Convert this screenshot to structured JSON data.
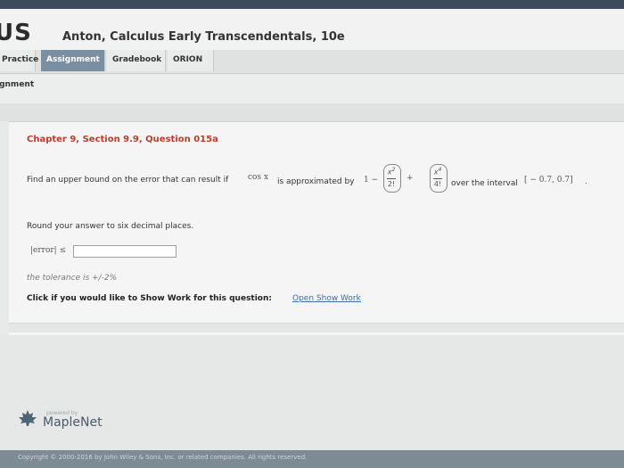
{
  "header": {
    "logo_text": "US",
    "book_title": "Anton, Calculus Early Transcendentals, 10e"
  },
  "tabs": [
    {
      "label": "Practice",
      "active": false
    },
    {
      "label": "Assignment",
      "active": true
    },
    {
      "label": "Gradebook",
      "active": false
    },
    {
      "label": "ORION",
      "active": false
    }
  ],
  "subtitle": "ignment",
  "question": {
    "title": "Chapter 9, Section 9.9, Question 015a",
    "prompt_part1": "Find an upper bound on the error that can result if",
    "func": "cos x",
    "prompt_part2": "is approximated by",
    "poly_const": "1 −",
    "poly_plus": "+",
    "term1_num": "x",
    "term1_exp": "2",
    "term1_den": "2!",
    "term2_num": "x",
    "term2_exp": "4",
    "term2_den": "4!",
    "prompt_part3": "over the interval",
    "interval": "[ − 0.7, 0.7]",
    "period": ".",
    "round_instruction": "Round your answer to six decimal places.",
    "error_label": "|error| ≤",
    "answer_value": "",
    "tolerance": "the tolerance is +/-2%",
    "showwork_text": "Click if you would like to Show Work for this question:",
    "showwork_link": "Open Show Work"
  },
  "footer": {
    "powered_by": "powered by",
    "maplenet": "MapleNet",
    "copyright": "Copyright © 2000-2016 by John Wiley & Sons, Inc. or related companies. All rights reserved."
  },
  "colors": {
    "accent_red": "#b5402c",
    "tab_active": "#7b8fa3",
    "link": "#3e6aa6"
  }
}
